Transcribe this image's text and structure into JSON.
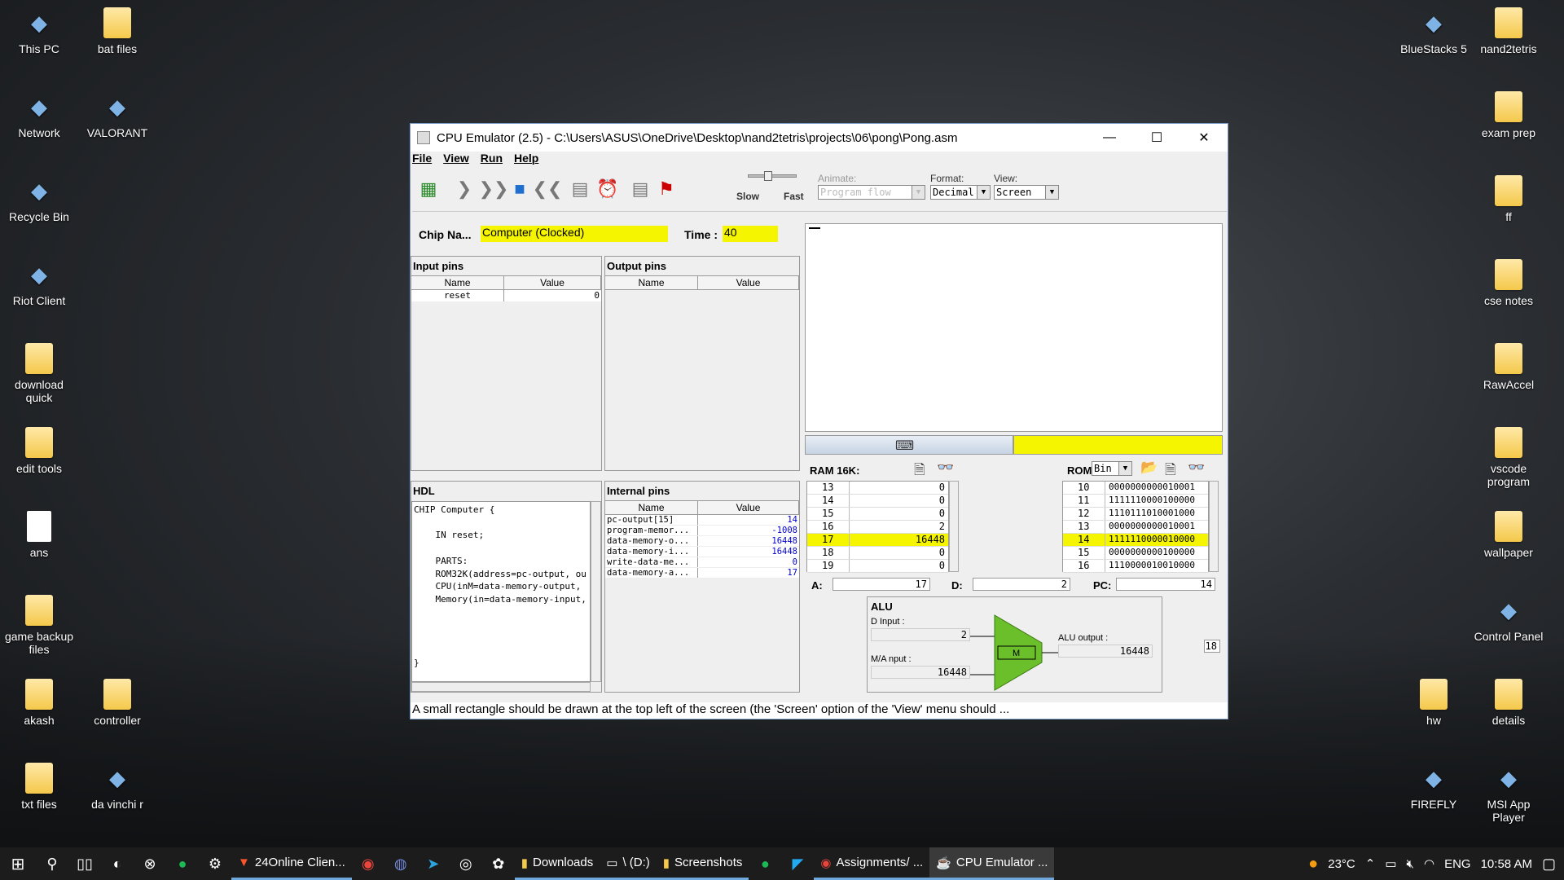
{
  "desktop": {
    "left_icons": [
      {
        "label": "This PC",
        "icon": "computer-icon"
      },
      {
        "label": "bat files",
        "icon": "folder-icon"
      },
      {
        "label": "Network",
        "icon": "network-icon"
      },
      {
        "label": "VALORANT",
        "icon": "valorant-icon"
      },
      {
        "label": "Recycle Bin",
        "icon": "recycle-bin-icon"
      },
      {
        "label": "Riot Client",
        "icon": "riot-client-icon"
      },
      {
        "label": "download quick",
        "icon": "folder-icon"
      },
      {
        "label": "edit tools",
        "icon": "folder-icon"
      },
      {
        "label": "ans",
        "icon": "document-icon"
      },
      {
        "label": "game backup files",
        "icon": "folder-icon"
      },
      {
        "label": "akash",
        "icon": "folder-icon"
      },
      {
        "label": "controller",
        "icon": "folder-icon"
      },
      {
        "label": "txt files",
        "icon": "folder-icon"
      },
      {
        "label": "da vinchi r",
        "icon": "davinci-icon"
      }
    ],
    "right_icons": [
      {
        "label": "BlueStacks 5",
        "icon": "bluestacks-icon"
      },
      {
        "label": "nand2tetris",
        "icon": "folder-icon"
      },
      {
        "label": "exam prep",
        "icon": "folder-icon"
      },
      {
        "label": "ff",
        "icon": "folder-icon"
      },
      {
        "label": "cse notes",
        "icon": "folder-icon"
      },
      {
        "label": "RawAccel",
        "icon": "folder-icon"
      },
      {
        "label": "vscode program",
        "icon": "folder-icon"
      },
      {
        "label": "wallpaper",
        "icon": "folder-icon"
      },
      {
        "label": "Control Panel",
        "icon": "control-panel-icon"
      },
      {
        "label": "hw",
        "icon": "folder-icon"
      },
      {
        "label": "details",
        "icon": "folder-icon"
      },
      {
        "label": "FIREFLY",
        "icon": "firefly-icon"
      },
      {
        "label": "MSI App Player",
        "icon": "msi-icon"
      }
    ]
  },
  "window": {
    "title": "CPU Emulator (2.5) - C:\\Users\\ASUS\\OneDrive\\Desktop\\nand2tetris\\projects\\06\\pong\\Pong.asm",
    "menu": [
      "File",
      "View",
      "Run",
      "Help"
    ],
    "speed": {
      "slow": "Slow",
      "fast": "Fast"
    },
    "animate": {
      "label": "Animate:",
      "value": "Program flow"
    },
    "format": {
      "label": "Format:",
      "value": "Decimal"
    },
    "view": {
      "label": "View:",
      "value": "Screen"
    },
    "chip_name_label": "Chip Na...",
    "chip_name_value": "Computer (Clocked)",
    "time_label": "Time :",
    "time_value": "40",
    "input_pins": {
      "title": "Input pins",
      "headers": [
        "Name",
        "Value"
      ],
      "rows": [
        {
          "name": "reset",
          "value": "0"
        }
      ]
    },
    "output_pins": {
      "title": "Output pins",
      "headers": [
        "Name",
        "Value"
      ]
    },
    "hdl": {
      "title": "HDL",
      "lines": [
        "CHIP Computer {",
        "",
        "    IN reset;",
        "",
        "    PARTS:",
        "    ROM32K(address=pc-output, ou",
        "    CPU(inM=data-memory-output,",
        "    Memory(in=data-memory-input,",
        "",
        "",
        "",
        "",
        "}"
      ]
    },
    "internal_pins": {
      "title": "Internal pins",
      "headers": [
        "Name",
        "Value"
      ],
      "rows": [
        {
          "name": "pc-output[15]",
          "value": "14"
        },
        {
          "name": "program-memor...",
          "value": "-1008"
        },
        {
          "name": "data-memory-o...",
          "value": "16448"
        },
        {
          "name": "data-memory-i...",
          "value": "16448"
        },
        {
          "name": "write-data-me...",
          "value": "0"
        },
        {
          "name": "data-memory-a...",
          "value": "17"
        }
      ]
    },
    "ram": {
      "title": "RAM 16K:",
      "rows": [
        {
          "addr": "13",
          "value": "0"
        },
        {
          "addr": "14",
          "value": "0"
        },
        {
          "addr": "15",
          "value": "0"
        },
        {
          "addr": "16",
          "value": "2"
        },
        {
          "addr": "17",
          "value": "16448"
        },
        {
          "addr": "18",
          "value": "0"
        },
        {
          "addr": "19",
          "value": "0"
        }
      ],
      "highlight_addr": "17"
    },
    "rom": {
      "title": "ROM:",
      "format": "Bin",
      "rows": [
        {
          "addr": "10",
          "value": "0000000000010001"
        },
        {
          "addr": "11",
          "value": "1111110000100000"
        },
        {
          "addr": "12",
          "value": "1110111010001000"
        },
        {
          "addr": "13",
          "value": "0000000000010001"
        },
        {
          "addr": "14",
          "value": "1111110000010000"
        },
        {
          "addr": "15",
          "value": "0000000000100000"
        },
        {
          "addr": "16",
          "value": "1110000010010000"
        }
      ],
      "highlight_addr": "14"
    },
    "registers": {
      "a_label": "A:",
      "a_value": "17",
      "d_label": "D:",
      "d_value": "2",
      "pc_label": "PC:",
      "pc_value": "14"
    },
    "alu": {
      "title": "ALU",
      "d_input_label": "D Input :",
      "d_input_value": "2",
      "ma_input_label": "M/A  nput :",
      "ma_input_value": "16448",
      "output_label": "ALU output :",
      "output_value": "16448",
      "op": "M",
      "side_value": "18"
    },
    "status": "A small rectangle should be drawn at the top left of the screen (the 'Screen' option of the 'View' menu should ..."
  },
  "taskbar": {
    "apps": [
      {
        "label": "24Online Clien...",
        "icon": "brave-icon"
      },
      {
        "label": "Downloads",
        "icon": "folder-icon"
      },
      {
        "label": "\\ (D:)",
        "icon": "drive-icon"
      },
      {
        "label": "Screenshots",
        "icon": "folder-icon"
      },
      {
        "label": "Assignments/ ...",
        "icon": "chrome-icon"
      },
      {
        "label": "CPU Emulator ...",
        "icon": "java-icon"
      }
    ],
    "weather": "23°C",
    "language": "ENG",
    "time": "10:58 AM"
  },
  "colors": {
    "highlight": "#f5f500",
    "alu_green": "#6abf2a",
    "blue_value": "#0000cc"
  }
}
